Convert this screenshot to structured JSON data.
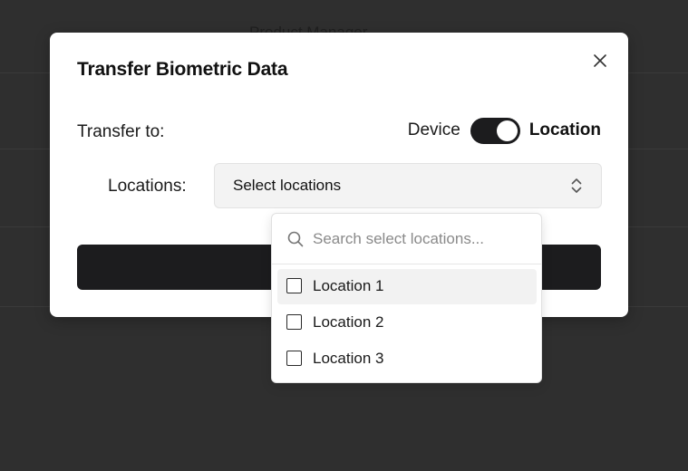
{
  "background": {
    "header_text": "Product Manager"
  },
  "modal": {
    "title": "Transfer Biometric Data",
    "transfer_label": "Transfer to:",
    "toggle": {
      "left_label": "Device",
      "right_label": "Location",
      "state": "Location"
    },
    "locations_label": "Locations:",
    "select": {
      "placeholder": "Select locations"
    },
    "primary_button_label": ""
  },
  "dropdown": {
    "search": {
      "placeholder": "Search select locations...",
      "value": ""
    },
    "options": [
      {
        "label": "Location 1",
        "checked": false,
        "highlighted": true
      },
      {
        "label": "Location 2",
        "checked": false,
        "highlighted": false
      },
      {
        "label": "Location 3",
        "checked": false,
        "highlighted": false
      }
    ]
  },
  "colors": {
    "overlay": "#2f2f2f",
    "modal_bg": "#ffffff",
    "dark": "#1c1c1e",
    "select_bg": "#f3f3f3"
  }
}
